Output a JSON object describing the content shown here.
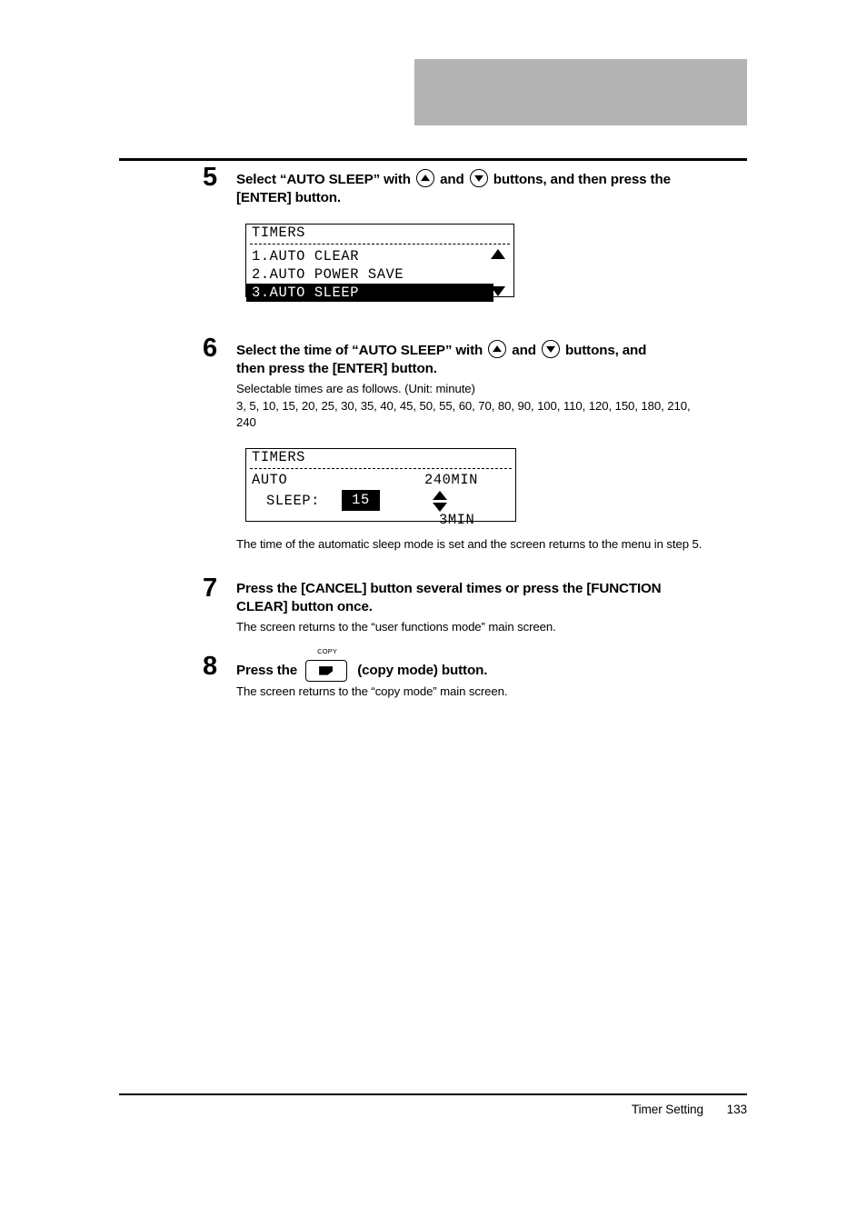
{
  "header": {
    "band_color": "#b3b3b3"
  },
  "steps": [
    {
      "number": "5",
      "title_part1": "Select “AUTO SLEEP” with",
      "title_and": "and",
      "title_part2": "buttons, and then press the",
      "title_part3": "[ENTER] button."
    },
    {
      "number": "6",
      "title_part1": "Select the time of “AUTO SLEEP” with",
      "title_and": "and",
      "title_part2": "buttons, and",
      "title_part3": "then press the [ENTER] button.",
      "body_line1": "Selectable times are as follows. (Unit: minute)",
      "body_line2": "3, 5, 10, 15, 20, 25, 30, 35, 40, 45, 50, 55, 60, 70, 80, 90, 100, 110, 120, 150, 180, 210,",
      "body_line3": "240",
      "after_panel_note": "The time of the automatic sleep mode is set and the screen returns to the menu in step 5."
    },
    {
      "number": "7",
      "title_line1": "Press the [CANCEL] button several times or press the [FUNCTION",
      "title_line2": "CLEAR] button once.",
      "body": "The screen returns to the “user functions mode” main screen."
    },
    {
      "number": "8",
      "title_part1": "Press the",
      "title_part2": "(copy mode) button.",
      "key_label": "COPY",
      "body": "The screen returns to the “copy mode” main screen."
    }
  ],
  "lcd_menu": {
    "title": "TIMERS",
    "rows": [
      {
        "text": "1.AUTO CLEAR",
        "selected": false
      },
      {
        "text": "2.AUTO POWER SAVE",
        "selected": false
      },
      {
        "text": "3.AUTO SLEEP",
        "selected": true
      }
    ],
    "scroll_up_icon": "triangle-up",
    "scroll_down_icon": "triangle-down"
  },
  "lcd_value": {
    "title": "TIMERS",
    "label_line1": "AUTO",
    "label_line2": "SLEEP:",
    "value": "15",
    "max_label": "240MIN",
    "min_label": "3MIN",
    "adjust_icon": "double-arrow-up-down"
  },
  "footer": {
    "section": "Timer Setting",
    "page": "133"
  }
}
